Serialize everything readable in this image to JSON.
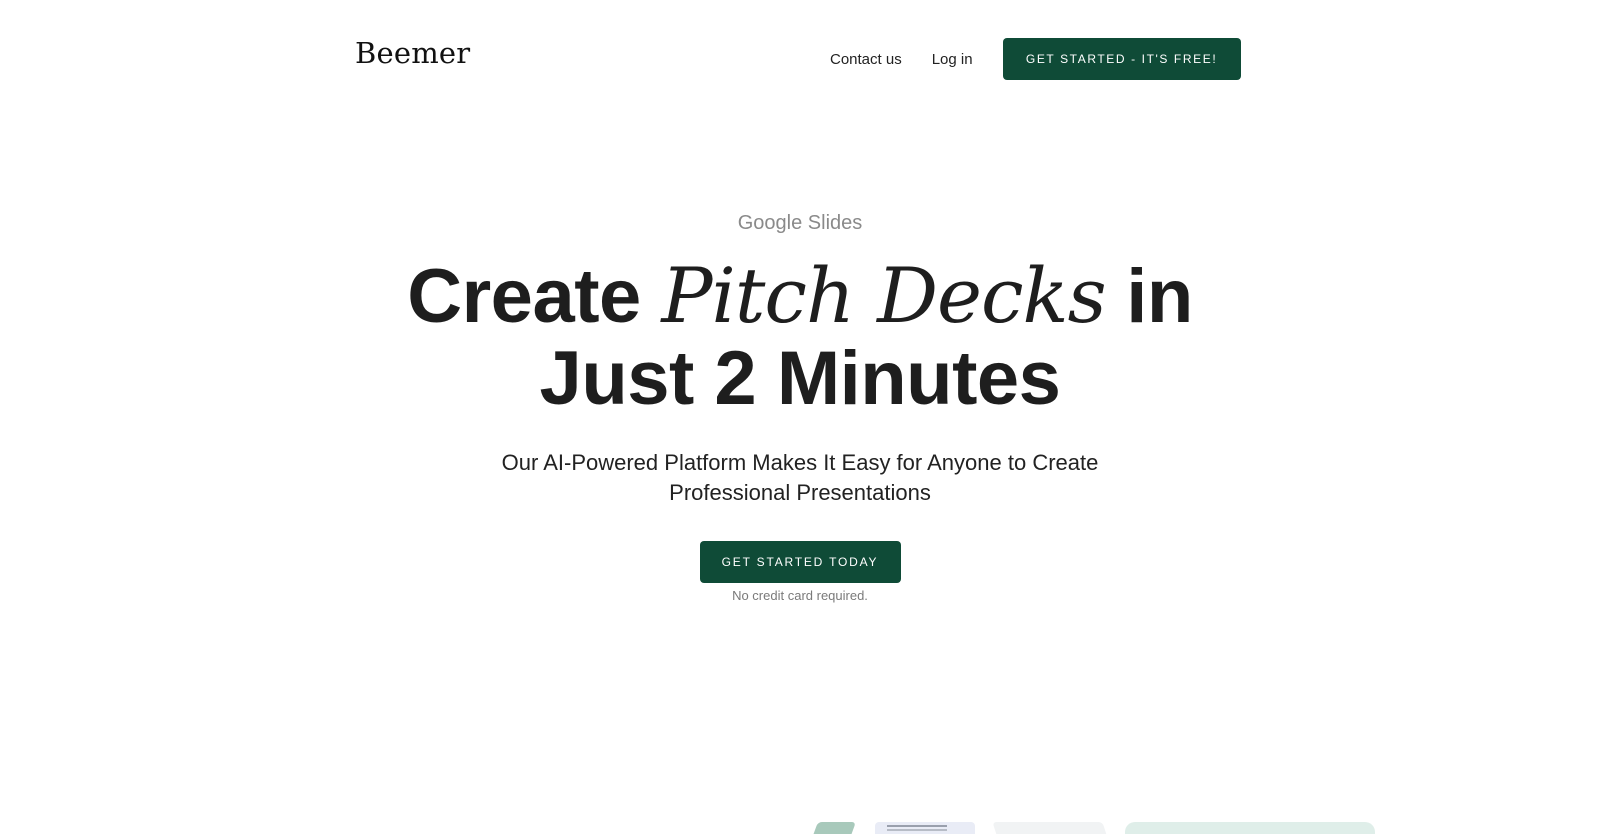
{
  "header": {
    "brand": "Beemer",
    "nav": {
      "contact": "Contact us",
      "login": "Log in",
      "cta": "GET STARTED - IT'S FREE!"
    }
  },
  "hero": {
    "eyebrow": "Google Slides",
    "headline": {
      "part1": "Create",
      "accent": "Pitch Decks",
      "part2": "in",
      "line2": "Just 2 Minutes"
    },
    "subhead": "Our AI-Powered Platform Makes It Easy for Anyone to Create Professional Presentations",
    "cta": "GET STARTED TODAY",
    "note": "No credit card required."
  },
  "colors": {
    "brand_green": "#0f4b37",
    "text_dark": "#1e1e1e",
    "text_muted": "#8a8a8a"
  }
}
